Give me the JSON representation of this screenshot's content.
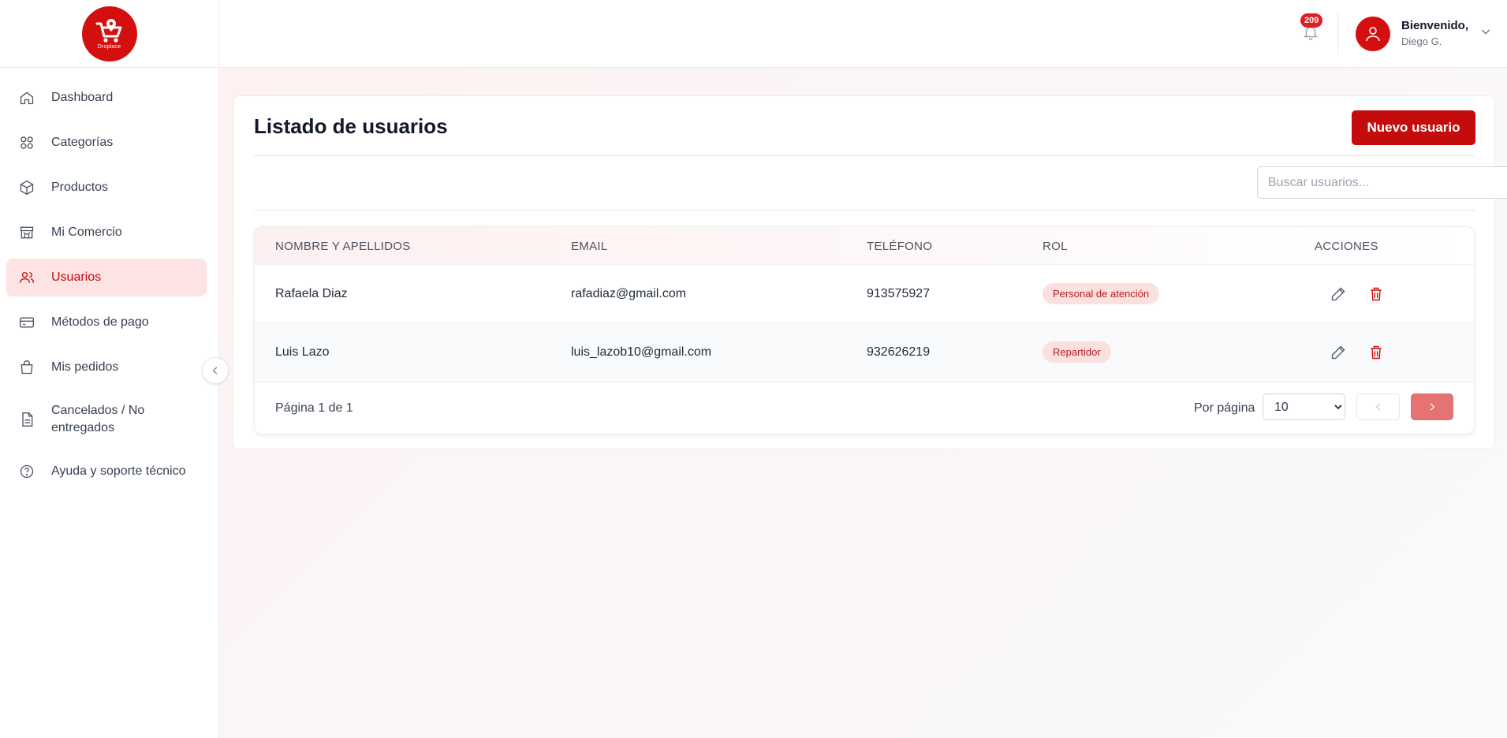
{
  "app": {
    "logo_text": "Droplace"
  },
  "sidebar": {
    "items": [
      {
        "label": "Dashboard",
        "icon": "home-icon",
        "active": false
      },
      {
        "label": "Categorías",
        "icon": "grid-icon",
        "active": false
      },
      {
        "label": "Productos",
        "icon": "box-icon",
        "active": false
      },
      {
        "label": "Mi Comercio",
        "icon": "store-icon",
        "active": false
      },
      {
        "label": "Usuarios",
        "icon": "users-icon",
        "active": true
      },
      {
        "label": "Métodos de pago",
        "icon": "credit-card-icon",
        "active": false
      },
      {
        "label": "Mis pedidos",
        "icon": "shopping-bag-icon",
        "active": false
      },
      {
        "label": "Cancelados / No entregados",
        "icon": "document-icon",
        "active": false
      },
      {
        "label": "Ayuda y soporte técnico",
        "icon": "help-circle-icon",
        "active": false
      }
    ]
  },
  "header": {
    "notification_count": "209",
    "greeting": "Bienvenido,",
    "user_name": "Diego G."
  },
  "main": {
    "title": "Listado de usuarios",
    "new_button_label": "Nuevo usuario",
    "search_placeholder": "Buscar usuarios...",
    "table": {
      "columns": [
        "NOMBRE Y APELLIDOS",
        "EMAIL",
        "TELÉFONO",
        "ROL",
        "ACCIONES"
      ],
      "rows": [
        {
          "name": "Rafaela Diaz",
          "email": "rafadiaz@gmail.com",
          "phone": "913575927",
          "role": "Personal de atención"
        },
        {
          "name": "Luis Lazo",
          "email": "luis_lazob10@gmail.com",
          "phone": "932626219",
          "role": "Repartidor"
        }
      ]
    },
    "pagination": {
      "page_info": "Página 1 de 1",
      "per_page_label": "Por página",
      "per_page_value": "10"
    }
  },
  "colors": {
    "brand": "#c40c0c",
    "active_bg": "#fde3e3",
    "badge_bg": "#fbe0e0"
  }
}
